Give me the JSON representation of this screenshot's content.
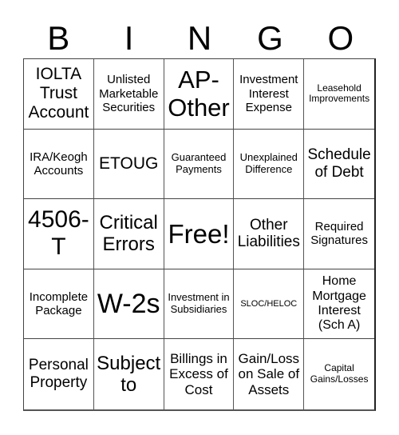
{
  "header": {
    "letters": [
      "B",
      "I",
      "N",
      "G",
      "O"
    ]
  },
  "grid": {
    "cells": [
      "IOLTA Trust Account",
      "Unlisted Marketable Securities",
      "AP-Other",
      "Investment Interest Expense",
      "Leasehold Improvements",
      "IRA/Keogh Accounts",
      "ETOUG",
      "Guaranteed Payments",
      "Unexplained Difference",
      "Schedule of Debt",
      "4506-T",
      "Critical Errors",
      "Free!",
      "Other Liabilities",
      "Required Signatures",
      "Incomplete Package",
      "W-2s",
      "Investment in Subsidiaries",
      "SLOC/HELOC",
      "Home Mortgage Interest (Sch A)",
      "Personal Property",
      "Subject to",
      "Billings in Excess of Cost",
      "Gain/Loss on Sale of Assets",
      "Capital Gains/Losses"
    ]
  }
}
